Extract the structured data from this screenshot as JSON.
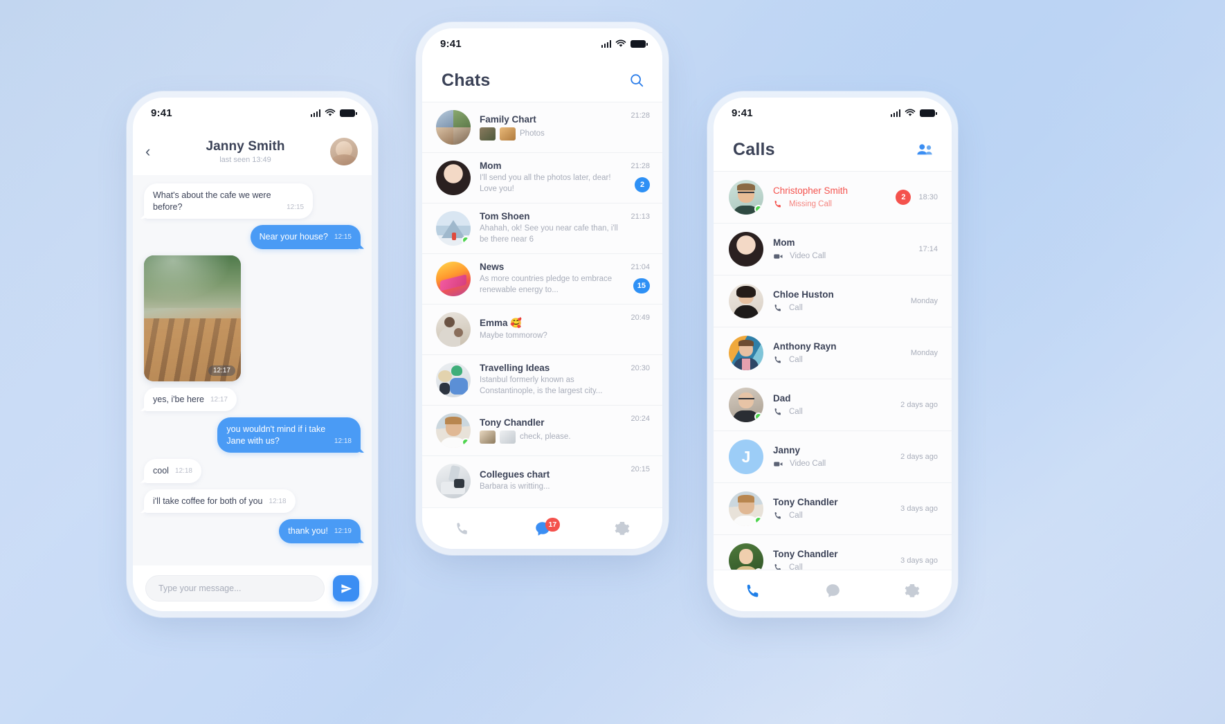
{
  "theme": {
    "accent_blue": "#4a9bf5",
    "badge_blue": "#2e90f5",
    "missed_red": "#f4524d",
    "online_green": "#4ed44e",
    "text_dark": "#3b4257",
    "text_muted": "#a8adba",
    "background": "#c2d6f0"
  },
  "chat_screen": {
    "status_time": "9:41",
    "back_icon": "chevron-left-icon",
    "contact_name": "Janny Smith",
    "contact_status": "last seen 13:49",
    "messages": [
      {
        "type": "text",
        "dir": "in",
        "text": "What's about the cafe we were before?",
        "time": "12:15"
      },
      {
        "type": "text",
        "dir": "out",
        "text": "Near your house?",
        "time": "12:15"
      },
      {
        "type": "photo",
        "dir": "in",
        "time": "12:17"
      },
      {
        "type": "text",
        "dir": "in",
        "text": "yes, i'be here",
        "time": "12:17"
      },
      {
        "type": "text",
        "dir": "out",
        "text": "you wouldn't mind if i take Jane with us?",
        "time": "12:18"
      },
      {
        "type": "text",
        "dir": "in",
        "text": "cool",
        "time": "12:18"
      },
      {
        "type": "text",
        "dir": "in",
        "text": "i'll take coffee for both of you",
        "time": "12:18"
      },
      {
        "type": "text",
        "dir": "out",
        "text": "thank you!",
        "time": "12:19"
      }
    ],
    "input_placeholder": "Type your message...",
    "send_icon": "send-icon"
  },
  "chats_screen": {
    "status_time": "9:41",
    "title": "Chats",
    "search_icon": "search-icon",
    "rows": [
      {
        "name": "Family Chart",
        "preview": "Photos",
        "time": "21:28",
        "badge": "",
        "online": false,
        "thumbs": true,
        "avatar_kind": "collage"
      },
      {
        "name": "Mom",
        "preview": "I'll send you all the photos later, dear! Love you!",
        "time": "21:28",
        "badge": "2",
        "online": false,
        "thumbs": false,
        "avatar_kind": "mom"
      },
      {
        "name": "Tom Shoen",
        "preview": "Ahahah, ok! See you near cafe than, i'll be there near 6",
        "time": "21:13",
        "badge": "",
        "online": true,
        "thumbs": false,
        "avatar_kind": "mountain"
      },
      {
        "name": "News",
        "preview": "As more countries pledge to embrace renewable energy to...",
        "time": "21:04",
        "badge": "15",
        "online": false,
        "thumbs": false,
        "avatar_kind": "news"
      },
      {
        "name": "Emma 🥰",
        "preview": "Maybe tommorow?",
        "time": "20:49",
        "badge": "",
        "online": false,
        "thumbs": false,
        "avatar_kind": "emma"
      },
      {
        "name": "Travelling Ideas",
        "preview": "Istanbul  formerly known as Constantinople, is the largest city...",
        "time": "20:30",
        "badge": "",
        "online": false,
        "thumbs": false,
        "avatar_kind": "travel"
      },
      {
        "name": "Tony Chandler",
        "preview": "check, please.",
        "time": "20:24",
        "badge": "",
        "online": true,
        "thumbs": true,
        "avatar_kind": "tony"
      },
      {
        "name": "Collegues chart",
        "preview": "Barbara is writting...",
        "time": "20:15",
        "badge": "",
        "online": false,
        "thumbs": false,
        "avatar_kind": "office"
      }
    ],
    "tabs": [
      {
        "icon": "phone-icon",
        "active": false,
        "badge": ""
      },
      {
        "icon": "chat-bubble-icon",
        "active": true,
        "badge": "17"
      },
      {
        "icon": "gear-icon",
        "active": false,
        "badge": ""
      }
    ]
  },
  "calls_screen": {
    "status_time": "9:41",
    "title": "Calls",
    "contacts_icon": "contacts-icon",
    "rows": [
      {
        "name": "Christopher Smith",
        "type": "Missing Call",
        "type_icon": "phone-icon",
        "time": "18:30",
        "badge": "2",
        "missed": true,
        "online": true,
        "avatar_kind": "chris"
      },
      {
        "name": "Mom",
        "type": "Video Call",
        "type_icon": "video-icon",
        "time": "17:14",
        "badge": "",
        "missed": false,
        "online": false,
        "avatar_kind": "mom"
      },
      {
        "name": "Chloe Huston",
        "type": "Call",
        "type_icon": "phone-icon",
        "time": "Monday",
        "badge": "",
        "missed": false,
        "online": false,
        "avatar_kind": "chloe"
      },
      {
        "name": "Anthony Rayn",
        "type": "Call",
        "type_icon": "phone-icon",
        "time": "Monday",
        "badge": "",
        "missed": false,
        "online": false,
        "avatar_kind": "anthony"
      },
      {
        "name": "Dad",
        "type": "Call",
        "type_icon": "phone-icon",
        "time": "2 days ago",
        "badge": "",
        "missed": false,
        "online": true,
        "avatar_kind": "dad"
      },
      {
        "name": "Janny",
        "type": "Video Call",
        "type_icon": "video-icon",
        "time": "2 days ago",
        "badge": "",
        "missed": false,
        "online": false,
        "avatar_kind": "letter",
        "letter": "J"
      },
      {
        "name": "Tony Chandler",
        "type": "Call",
        "type_icon": "phone-icon",
        "time": "3 days ago",
        "badge": "",
        "missed": false,
        "online": true,
        "avatar_kind": "tony"
      },
      {
        "name": "Tony Chandler",
        "type": "Call",
        "type_icon": "phone-icon",
        "time": "3 days ago",
        "badge": "",
        "missed": false,
        "online": true,
        "avatar_kind": "girl"
      }
    ],
    "tabs": [
      {
        "icon": "phone-icon",
        "active": true,
        "badge": ""
      },
      {
        "icon": "chat-bubble-icon",
        "active": false,
        "badge": ""
      },
      {
        "icon": "gear-icon",
        "active": false,
        "badge": ""
      }
    ]
  }
}
